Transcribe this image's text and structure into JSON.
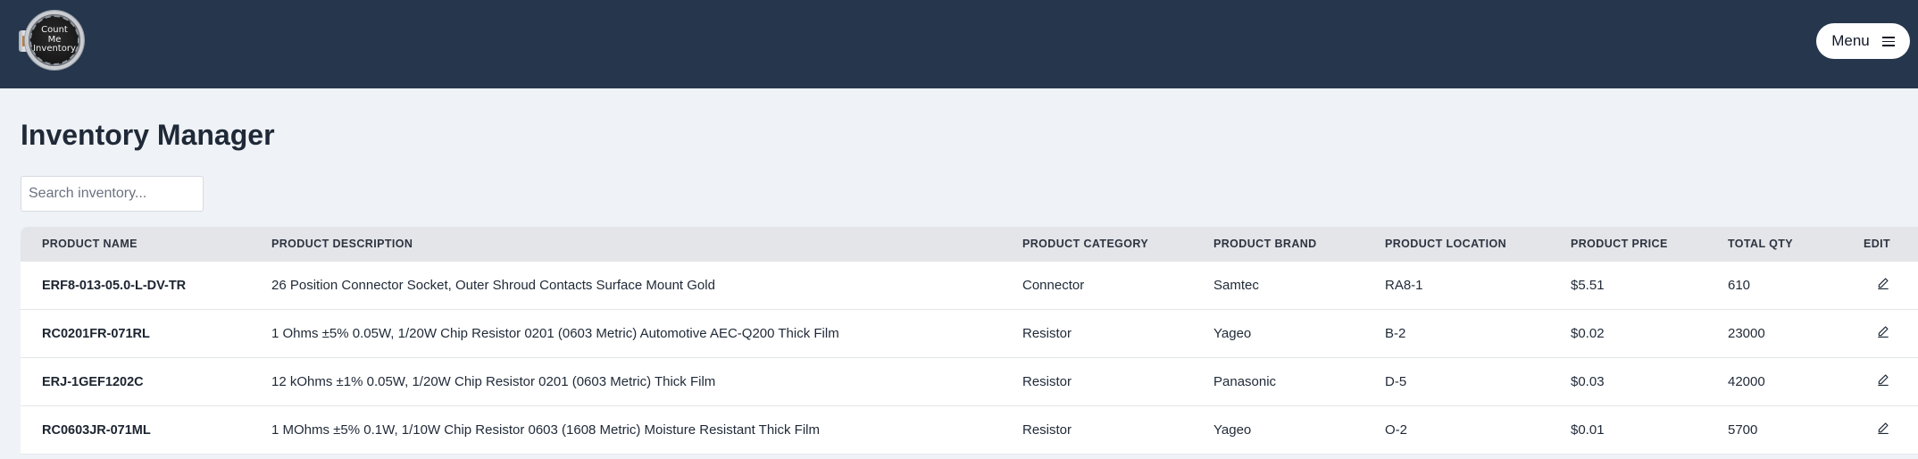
{
  "navbar": {
    "logo_lines": [
      "Count",
      "Me",
      "Inventory"
    ],
    "menu_label": "Menu",
    "background": "#26374d"
  },
  "page": {
    "title": "Inventory Manager"
  },
  "search": {
    "placeholder": "Search inventory...",
    "value": ""
  },
  "table": {
    "columns": [
      "PRODUCT NAME",
      "PRODUCT DESCRIPTION",
      "PRODUCT CATEGORY",
      "PRODUCT BRAND",
      "PRODUCT LOCATION",
      "PRODUCT PRICE",
      "TOTAL QTY",
      "EDIT"
    ],
    "rows": [
      {
        "name": "ERF8-013-05.0-L-DV-TR",
        "description": "26 Position Connector Socket, Outer Shroud Contacts Surface Mount Gold",
        "category": "Connector",
        "brand": "Samtec",
        "location": "RA8-1",
        "price": "$5.51",
        "qty": "610",
        "edit_icon": "pencil-icon"
      },
      {
        "name": "RC0201FR-071RL",
        "description": "1 Ohms ±5% 0.05W, 1/20W Chip Resistor 0201 (0603 Metric) Automotive AEC-Q200 Thick Film",
        "category": "Resistor",
        "brand": "Yageo",
        "location": "B-2",
        "price": "$0.02",
        "qty": "23000",
        "edit_icon": "pencil-icon"
      },
      {
        "name": "ERJ-1GEF1202C",
        "description": "12 kOhms ±1% 0.05W, 1/20W Chip Resistor 0201 (0603 Metric) Thick Film",
        "category": "Resistor",
        "brand": "Panasonic",
        "location": "D-5",
        "price": "$0.03",
        "qty": "42000",
        "edit_icon": "pencil-icon"
      },
      {
        "name": "RC0603JR-071ML",
        "description": "1 MOhms ±5% 0.1W, 1/10W Chip Resistor 0603 (1608 Metric) Moisture Resistant Thick Film",
        "category": "Resistor",
        "brand": "Yageo",
        "location": "O-2",
        "price": "$0.01",
        "qty": "5700",
        "edit_icon": "pencil-icon"
      }
    ]
  }
}
